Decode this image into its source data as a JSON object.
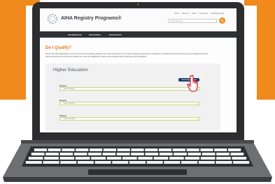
{
  "colors": {
    "accent": "#f08a1c",
    "nav": "#2f3033",
    "button": "#1f3f6e"
  },
  "header": {
    "logo_text": "AIHA Registry Programs®",
    "utility_links": [
      "Home",
      "About Us",
      "News",
      "Contact Us",
      "Candidate Login"
    ],
    "search_placeholder": "Search this site..."
  },
  "nav": {
    "items": [
      "INFORMATION",
      "REGISTRIES",
      "RESOURCES"
    ]
  },
  "main": {
    "title": "Do I Qualify?",
    "intro": "Fill out the online application to see if you have the necessary education and work experience to sit for the competency assessment. Providing a complete and accurate picture of your education and work history will allow you to determine whether you meet the qualification criteria of the program before submitting your application.",
    "section_title": "Higher Education",
    "add_button": "Add Another Degree",
    "fields": [
      {
        "label": "Degree",
        "placeholder": "Select Degree"
      },
      {
        "label": "Degree",
        "placeholder": "Select Degree"
      },
      {
        "label": "Degree",
        "placeholder": "Select Degree"
      }
    ]
  }
}
